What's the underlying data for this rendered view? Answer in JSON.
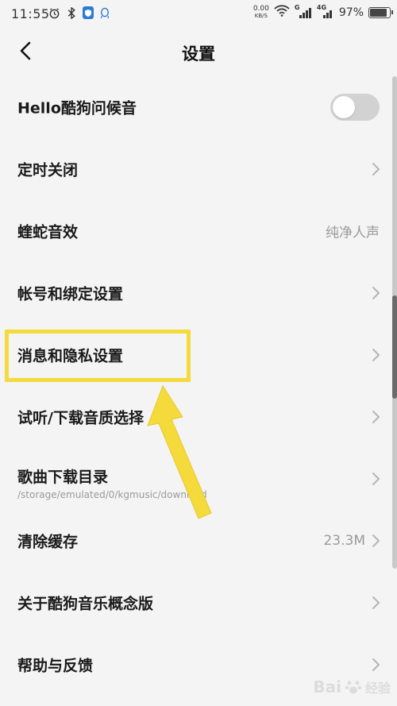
{
  "status_bar": {
    "time": "11:55",
    "speed_value": "0.00",
    "speed_unit": "KB/S",
    "network_a": "G",
    "network_b": "4G",
    "battery": "97%",
    "battery_level": 0.97,
    "left_icons": [
      "alarm-icon",
      "bluetooth-icon",
      "shield-icon",
      "qq-icon"
    ]
  },
  "header": {
    "title": "设置",
    "back_icon": "chevron-left-icon"
  },
  "settings": {
    "items": [
      {
        "label": "Hello酷狗问候音",
        "type": "toggle",
        "value": "",
        "toggle_on": false
      },
      {
        "label": "定时关闭",
        "type": "chevron",
        "value": ""
      },
      {
        "label": "蝰蛇音效",
        "type": "value",
        "value": "纯净人声"
      },
      {
        "label": "帐号和绑定设置",
        "type": "chevron",
        "value": ""
      },
      {
        "label": "消息和隐私设置",
        "type": "chevron",
        "value": ""
      },
      {
        "label": "试听/下载音质选择",
        "type": "chevron",
        "value": ""
      },
      {
        "label": "歌曲下载目录",
        "type": "chevron",
        "value": "",
        "sub": "/storage/emulated/0/kgmusic/download"
      },
      {
        "label": "清除缓存",
        "type": "value",
        "value": "23.3M"
      },
      {
        "label": "关于酷狗音乐概念版",
        "type": "chevron",
        "value": ""
      },
      {
        "label": "帮助与反馈",
        "type": "chevron",
        "value": ""
      }
    ]
  },
  "annotation": {
    "highlight_color": "#f5da3c",
    "arrow_color": "#f5da3c"
  },
  "watermark": {
    "brand": "Bai",
    "brand_suffix": "经验",
    "icon": "paw-icon"
  },
  "colors": {
    "background": "#f4f4f4",
    "primary_text": "#1a1a1a",
    "secondary_text": "#9a9a9a",
    "toggle_off": "#d2d2d2"
  }
}
